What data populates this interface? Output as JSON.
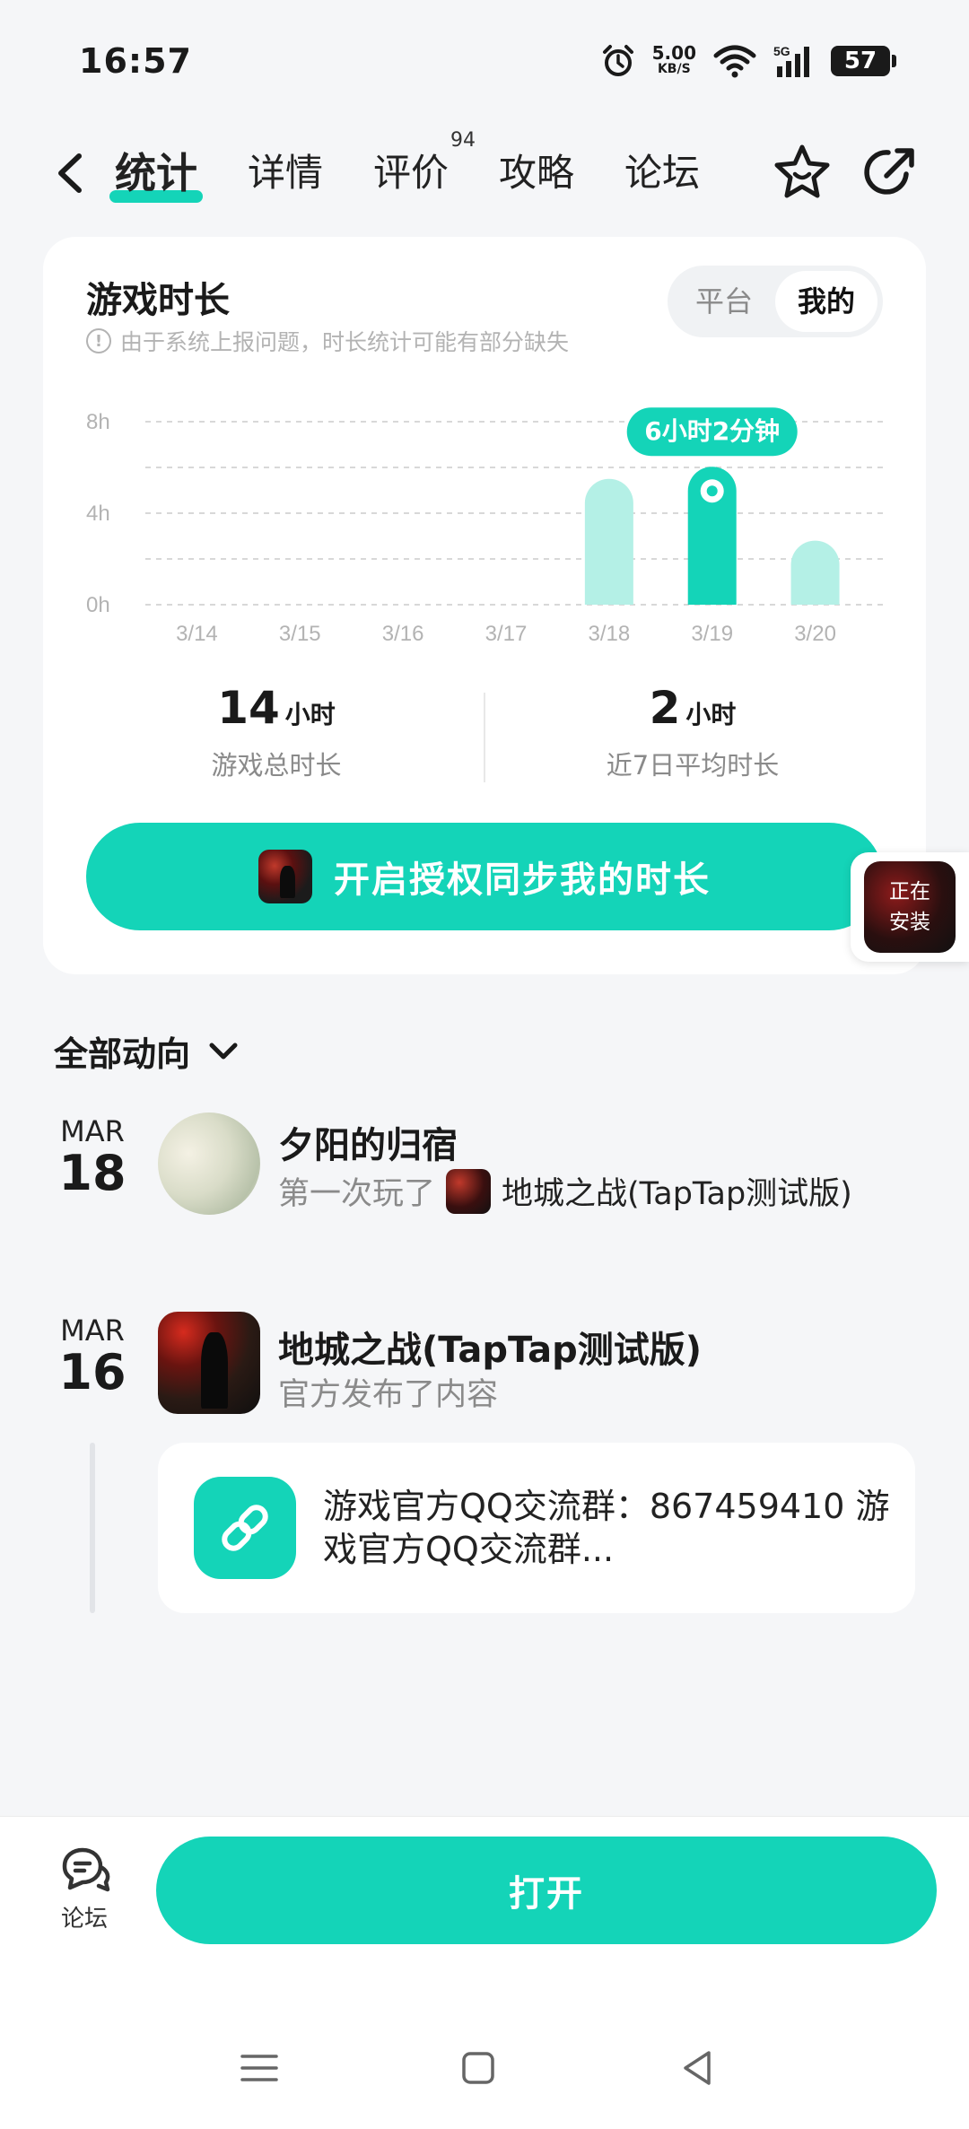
{
  "status": {
    "time": "16:57",
    "net_speed": "5.00",
    "net_unit": "KB/S",
    "battery": "57"
  },
  "header": {
    "tabs": [
      {
        "label": "统计",
        "active": true
      },
      {
        "label": "详情"
      },
      {
        "label": "评价",
        "badge": "94"
      },
      {
        "label": "攻略"
      },
      {
        "label": "论坛"
      }
    ]
  },
  "stats_card": {
    "title": "游戏时长",
    "note": "由于系统上报问题，时长统计可能有部分缺失",
    "segments": [
      "平台",
      "我的"
    ],
    "active_segment": "我的",
    "total_value": "14",
    "total_unit": "小时",
    "total_label": "游戏总时长",
    "avg_value": "2",
    "avg_unit": "小时",
    "avg_label": "近7日平均时长",
    "cta_label": "开启授权同步我的时长",
    "installing_label_line1": "正在",
    "installing_label_line2": "安装"
  },
  "chart_data": {
    "type": "bar",
    "categories": [
      "3/14",
      "3/15",
      "3/16",
      "3/17",
      "3/18",
      "3/19",
      "3/20"
    ],
    "values": [
      0,
      0,
      0,
      0,
      5.5,
      6.03,
      2.8
    ],
    "ylim": [
      0,
      8
    ],
    "yticks": [
      "0h",
      "4h",
      "8h"
    ],
    "highlight_index": 5,
    "highlight_label": "6小时2分钟",
    "grid": true,
    "colors": {
      "bar": "#b4f0e6",
      "highlight": "#14d4b8"
    }
  },
  "feed": {
    "title": "全部动向",
    "items": [
      {
        "month": "MAR",
        "day": "18",
        "name": "夕阳的归宿",
        "action": "第一次玩了",
        "game": "地城之战(TapTap测试版)"
      },
      {
        "month": "MAR",
        "day": "16",
        "name": "地城之战(TapTap测试版)",
        "action": "官方发布了内容",
        "link_text": "游戏官方QQ交流群：867459410 游戏官方QQ交流群..."
      }
    ]
  },
  "bottom": {
    "forum_label": "论坛",
    "open_label": "打开"
  },
  "colors": {
    "accent": "#14d4b8",
    "accent_light": "#b4f0e6",
    "background": "#f5f6f8"
  }
}
